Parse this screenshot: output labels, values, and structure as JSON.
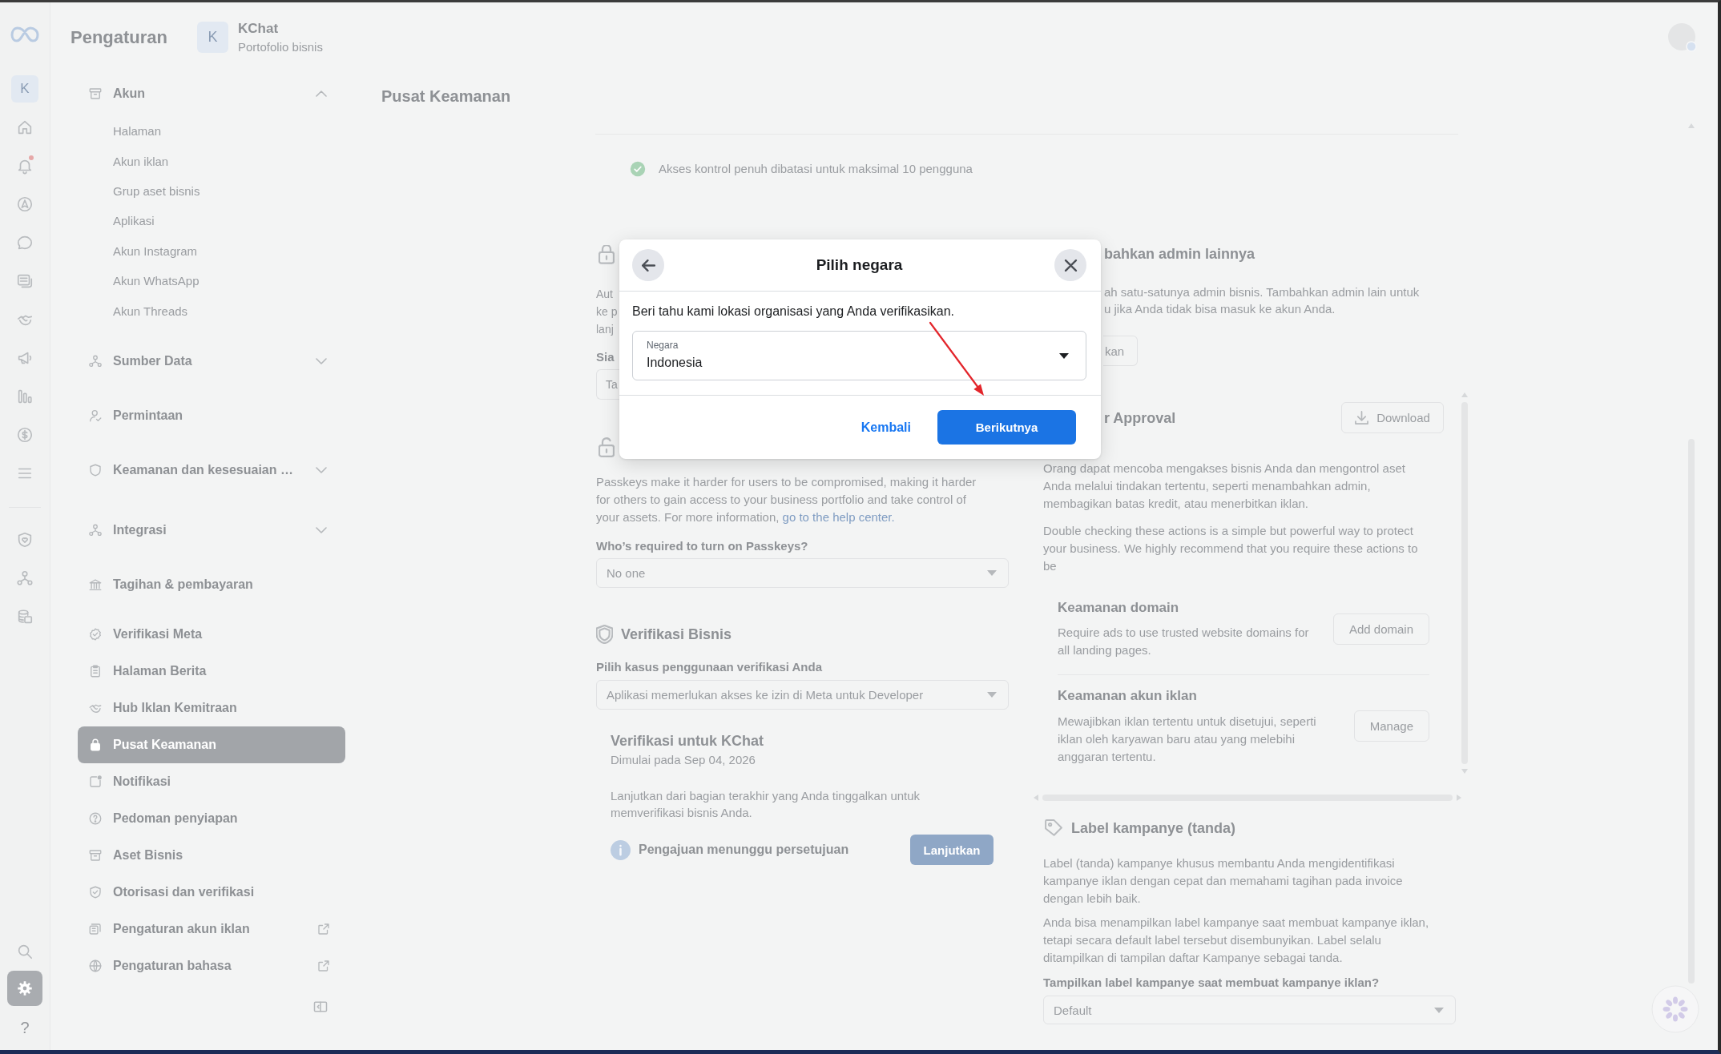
{
  "rail": {
    "avatar": "K",
    "items": [
      {
        "selected": false,
        "badge": false
      },
      {
        "selected": false,
        "badge": true
      },
      {
        "selected": false,
        "badge": false
      },
      {
        "selected": false,
        "badge": false
      },
      {
        "selected": false,
        "badge": false
      },
      {
        "selected": false,
        "badge": false
      },
      {
        "selected": false,
        "badge": false
      },
      {
        "selected": false,
        "badge": false
      },
      {
        "selected": false,
        "badge": false
      },
      {
        "selected": false,
        "badge": false
      }
    ],
    "tools": [
      {
        "selected": false
      },
      {
        "selected": false
      },
      {
        "selected": false
      }
    ],
    "bottom": [
      {
        "selected": false
      },
      {
        "selected": true
      }
    ],
    "help": "?"
  },
  "sidebar": {
    "title": "Pengaturan",
    "account": {
      "avatar": "K",
      "name": "KChat",
      "subtitle": "Portofolio bisnis"
    },
    "items": [
      {
        "label": "Akun",
        "kind": "group",
        "expanded": true,
        "selected": false,
        "children": [
          {
            "label": "Halaman",
            "selected": false
          },
          {
            "label": "Akun iklan",
            "selected": false
          },
          {
            "label": "Grup aset bisnis",
            "selected": false
          },
          {
            "label": "Aplikasi",
            "selected": false
          },
          {
            "label": "Akun Instagram",
            "selected": false
          },
          {
            "label": "Akun WhatsApp",
            "selected": false
          },
          {
            "label": "Akun Threads",
            "selected": false
          }
        ]
      },
      {
        "label": "Sumber Data",
        "kind": "group",
        "expanded": false,
        "selected": false
      },
      {
        "label": "Permintaan",
        "kind": "page",
        "selected": false
      },
      {
        "label": "Keamanan dan kesesuaian …",
        "kind": "group",
        "expanded": false,
        "selected": false
      },
      {
        "label": "Integrasi",
        "kind": "group",
        "expanded": false,
        "selected": false
      },
      {
        "label": "Tagihan & pembayaran",
        "kind": "page",
        "selected": false
      },
      {
        "label": "Verifikasi Meta",
        "kind": "page",
        "selected": false
      },
      {
        "label": "Halaman Berita",
        "kind": "page",
        "selected": false
      },
      {
        "label": "Hub Iklan Kemitraan",
        "kind": "page",
        "selected": false
      },
      {
        "label": "Pusat Keamanan",
        "kind": "page",
        "selected": true
      },
      {
        "label": "Notifikasi",
        "kind": "page",
        "selected": false
      },
      {
        "label": "Pedoman penyiapan",
        "kind": "page",
        "selected": false
      },
      {
        "label": "Aset Bisnis",
        "kind": "page",
        "selected": false
      },
      {
        "label": "Otorisasi dan verifikasi",
        "kind": "page",
        "selected": false
      },
      {
        "label": "Pengaturan akun iklan",
        "kind": "external",
        "selected": false
      },
      {
        "label": "Pengaturan bahasa",
        "kind": "external",
        "selected": false
      }
    ]
  },
  "main": {
    "title": "Pusat Keamanan",
    "notice": "Akses kontrol penuh dibatasi untuk maksimal 10 pengguna",
    "left": {
      "two_factor": {
        "text": "Aut\nke p\nlanj",
        "field_label": "Sia",
        "field_value": "Ta"
      },
      "passkeys": {
        "text": "Passkeys make it harder for users to be compromised, making it harder\nfor others to gain access to your business portfolio and take control of\nyour assets. For more information, ",
        "link": "go to the help center.",
        "question": "Who’s required to turn on Passkeys?",
        "value": "No one"
      },
      "verification": {
        "title": "Verifikasi Bisnis",
        "field_label": "Pilih kasus penggunaan verifikasi Anda",
        "value": "Aplikasi memerlukan akses ke izin di Meta untuk Developer",
        "card": {
          "title": "Verifikasi untuk KChat",
          "date": "Dimulai pada Sep 04, 2026",
          "text": "Lanjutkan dari bagian terakhir yang Anda tinggalkan untuk\nmemverifikasi bisnis Anda.",
          "status": "Pengajuan menunggu persetujuan",
          "button": "Lanjutkan"
        }
      }
    },
    "right": {
      "admins": {
        "title": "bahkan admin lainnya",
        "text": "ah satu-satunya admin bisnis. Tambahkan admin lain untuk\nu jika Anda tidak bisa masuk ke akun Anda.",
        "button": "kan"
      },
      "approval": {
        "title": "r Approval",
        "download": "Download",
        "paragraphs": [
          "Orang dapat mencoba mengakses bisnis Anda dan mengontrol aset\nAnda melalui tindakan tertentu, seperti menambahkan admin,\nmembagikan batas kredit, atau menerbitkan iklan.",
          "Double checking these actions is a simple but powerful way to protect\nyour business. We highly recommend that you require these actions to\nbe"
        ],
        "items": [
          {
            "title": "Keamanan domain",
            "text": "Require ads to use trusted website domains for\nall landing pages.",
            "button": "Add domain"
          },
          {
            "title": "Keamanan akun iklan",
            "text": "Mewajibkan iklan tertentu untuk disetujui, seperti\niklan oleh karyawan baru atau yang melebihi\nanggaran tertentu.",
            "button": "Manage"
          }
        ]
      },
      "labels": {
        "title": "Label kampanye (tanda)",
        "paragraphs": [
          "Label (tanda) kampanye khusus membantu Anda mengidentifikasi\nkampanye iklan dengan cepat dan memahami tagihan pada invoice\ndengan lebih baik.",
          "Anda bisa menampilkan label kampanye saat membuat kampanye iklan,\ntetapi secara default label tersebut disembunyikan. Label selalu\nditampilkan di tampilan daftar Kampanye sebagai tanda."
        ],
        "question": "Tampilkan label kampanye saat membuat kampanye iklan?",
        "value": "Default"
      }
    }
  },
  "dialog": {
    "title": "Pilih negara",
    "prompt": "Beri tahu kami lokasi organisasi yang Anda verifikasikan.",
    "field": {
      "label": "Negara",
      "value": "Indonesia"
    },
    "buttons": [
      {
        "label": "Kembali",
        "kind": "link"
      },
      {
        "label": "Berikutnya",
        "kind": "primary"
      }
    ]
  },
  "annotation": {
    "kind": "arrow"
  }
}
